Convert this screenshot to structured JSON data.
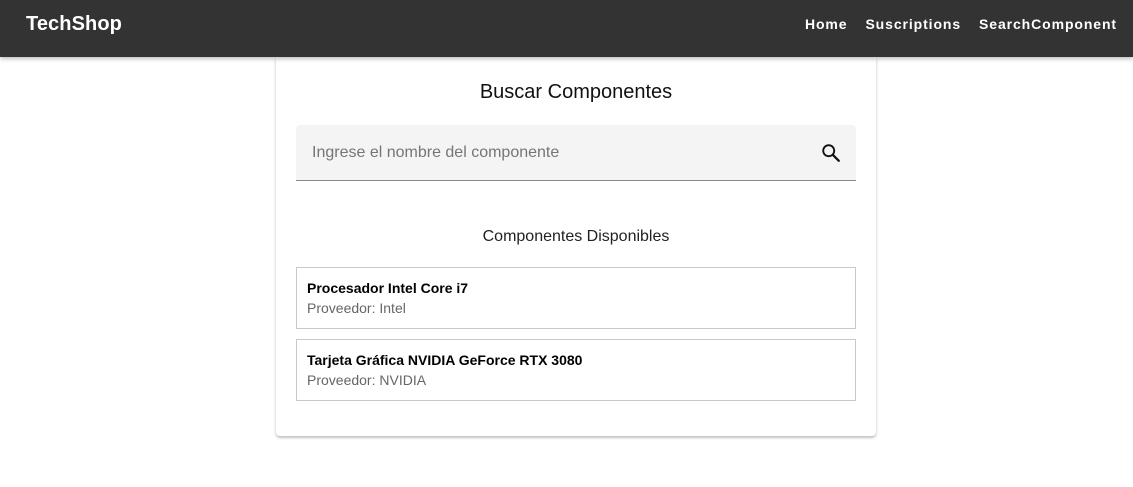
{
  "header": {
    "brand": "TechShop",
    "nav": [
      {
        "label": "Home"
      },
      {
        "label": "Suscriptions"
      },
      {
        "label": "SearchComponent"
      }
    ]
  },
  "search_card": {
    "title": "Buscar Componentes",
    "search": {
      "value": "",
      "placeholder": "Ingrese el nombre del componente",
      "icon": "search-icon"
    },
    "section_title": "Componentes Disponibles",
    "components": [
      {
        "name": "Procesador Intel Core i7",
        "provider": "Proveedor: Intel"
      },
      {
        "name": "Tarjeta Gráfica NVIDIA GeForce RTX 3080",
        "provider": "Proveedor: NVIDIA"
      }
    ]
  },
  "colors": {
    "topbar": "#333333",
    "field_background": "#f4f4f4",
    "item_border": "#c8c8c8"
  }
}
